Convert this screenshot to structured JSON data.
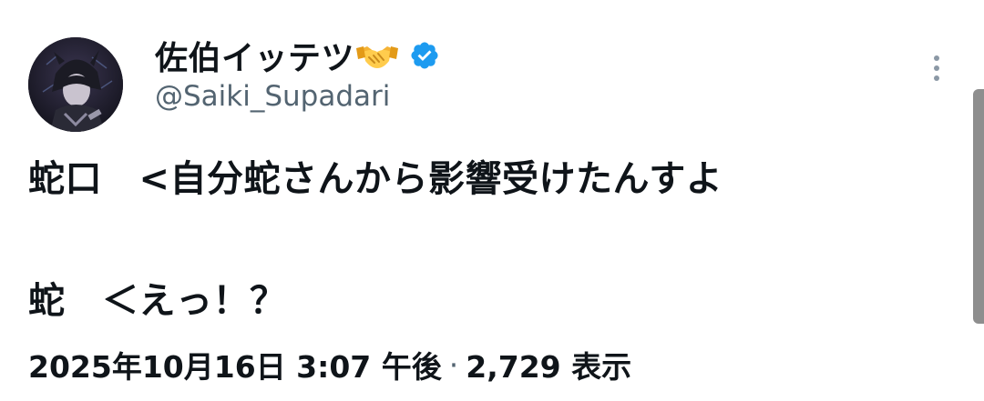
{
  "author": {
    "display_name": "佐伯イッテツ",
    "emoji_icon": "handshake-emoji",
    "verified_icon": "verified-badge-icon",
    "handle": "@Saiki_Supadari"
  },
  "tweet": {
    "lines": [
      "蛇口　<自分蛇さんから影響受けたんすよ",
      "蛇　＜えっ！？"
    ]
  },
  "meta": {
    "timestamp": "2025年10月16日 3:07 午後",
    "separator": "·",
    "views": "2,729 表示"
  },
  "colors": {
    "text": "#0f1419",
    "secondary": "#536471",
    "verified_blue": "#1d9bf0"
  }
}
